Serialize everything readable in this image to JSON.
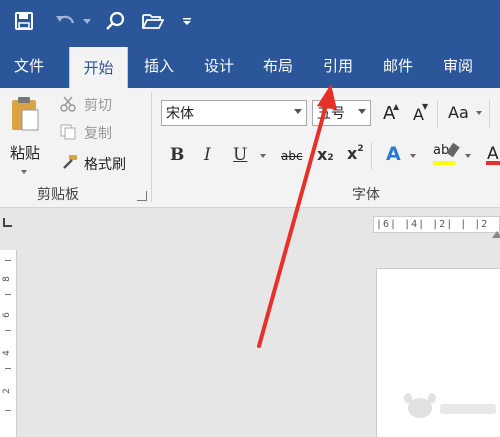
{
  "quick_access": {
    "save_icon": "save-icon",
    "undo_icon": "undo-icon",
    "search_icon": "search-icon",
    "open_icon": "folder-open-icon",
    "customize_icon": "customize-qat-icon"
  },
  "tabs": [
    {
      "label": "文件"
    },
    {
      "label": "开始"
    },
    {
      "label": "插入"
    },
    {
      "label": "设计"
    },
    {
      "label": "布局"
    },
    {
      "label": "引用"
    },
    {
      "label": "邮件"
    },
    {
      "label": "审阅"
    }
  ],
  "clipboard": {
    "paste_label": "粘贴",
    "cut_label": "剪切",
    "copy_label": "复制",
    "format_painter_label": "格式刷",
    "group_label": "剪贴板"
  },
  "font": {
    "font_name": "宋体",
    "font_size": "五号",
    "grow_label": "A",
    "shrink_label": "A",
    "case_label": "Aa",
    "bold_label": "B",
    "italic_label": "I",
    "underline_label": "U",
    "strike_label": "abc",
    "sub_label": "x",
    "sub_suffix": "2",
    "sup_label": "x",
    "sup_suffix": "2",
    "effects_label": "A",
    "highlight_label": "ab",
    "color_label": "A",
    "group_label": "字体"
  },
  "ruler": {
    "h_marks": "|6|  |4|  |2|  |  |2"
  },
  "vruler_marks": [
    "8",
    "6",
    "4",
    "2"
  ],
  "colors": {
    "accent": "#2b579a",
    "annotation_arrow": "#e8302a"
  }
}
